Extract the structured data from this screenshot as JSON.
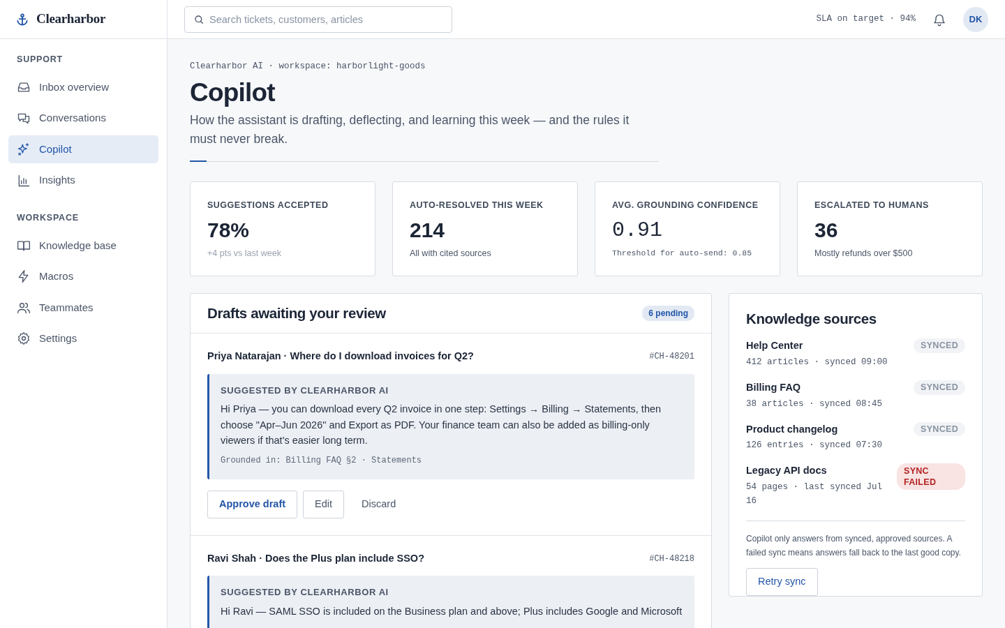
{
  "brand": {
    "name": "Clearharbor"
  },
  "nav": [
    {
      "heading": "SUPPORT",
      "items": [
        {
          "label": "Inbox overview",
          "selected": false
        },
        {
          "label": "Conversations",
          "selected": false
        },
        {
          "label": "Copilot",
          "selected": true
        },
        {
          "label": "Insights",
          "selected": false
        }
      ]
    },
    {
      "heading": "WORKSPACE",
      "items": [
        {
          "label": "Knowledge base",
          "selected": false
        },
        {
          "label": "Macros",
          "selected": false
        },
        {
          "label": "Teammates",
          "selected": false
        },
        {
          "label": "Settings",
          "selected": false
        }
      ]
    }
  ],
  "search": {
    "placeholder": "Search tickets, customers, articles"
  },
  "sla": "SLA on target · 94%",
  "avatar": "DK",
  "breadcrumb": "Clearharbor AI · workspace: harborlight-goods",
  "title": "Copilot",
  "subtitle": "How the assistant is drafting, deflecting, and learning this week — and the rules it must never break.",
  "stats": [
    {
      "label": "SUGGESTIONS ACCEPTED",
      "value": "78%",
      "note": "+4 pts vs last week",
      "kind": "faint"
    },
    {
      "label": "AUTO-RESOLVED THIS WEEK",
      "value": "214",
      "note": "All with cited sources",
      "kind": "plain"
    },
    {
      "label": "AVG. GROUNDING CONFIDENCE",
      "value": "0.91",
      "note": "Threshold for auto-send: 0.85",
      "kind": "mono"
    },
    {
      "label": "ESCALATED TO HUMANS",
      "value": "36",
      "note": "Mostly refunds over $500",
      "kind": "plain"
    }
  ],
  "drafts": {
    "title": "Drafts awaiting your review",
    "badge": "6 pending",
    "items": [
      {
        "heading": "Priya Natarajan · Where do I download invoices for Q2?",
        "ticket": "#CH-48201",
        "label": "SUGGESTED BY CLEARHARBOR AI",
        "body": "Hi Priya — you can download every Q2 invoice in one step: Settings → Billing → Statements, then choose \"Apr–Jun 2026\" and Export as PDF. Your finance team can also be added as billing-only viewers if that's easier long term.",
        "grounded": "Grounded in: Billing FAQ §2 · Statements",
        "actions": [
          {
            "label": "Approve draft",
            "kind": "primary"
          },
          {
            "label": "Edit",
            "kind": "outline"
          },
          {
            "label": "Discard",
            "kind": "link"
          }
        ]
      },
      {
        "heading": "Ravi Shah · Does the Plus plan include SSO?",
        "ticket": "#CH-48218",
        "label": "SUGGESTED BY CLEARHARBOR AI",
        "body": "Hi Ravi — SAML SSO is included on the Business plan and above; Plus includes Google and Microsoft"
      }
    ]
  },
  "sources": {
    "title": "Knowledge sources",
    "items": [
      {
        "name": "Help Center",
        "meta": "412 articles · synced 09:00",
        "status": "SYNCED",
        "kind": "synced"
      },
      {
        "name": "Billing FAQ",
        "meta": "38 articles · synced 08:45",
        "status": "SYNCED",
        "kind": "synced"
      },
      {
        "name": "Product changelog",
        "meta": "126 entries · synced 07:30",
        "status": "SYNCED",
        "kind": "synced"
      },
      {
        "name": "Legacy API docs",
        "meta": "54 pages · last synced Jul 16",
        "status": "SYNC FAILED",
        "kind": "failed"
      }
    ],
    "footnote": "Copilot only answers from synced, approved sources. A failed sync means answers fall back to the last good copy.",
    "button": "Retry sync"
  }
}
